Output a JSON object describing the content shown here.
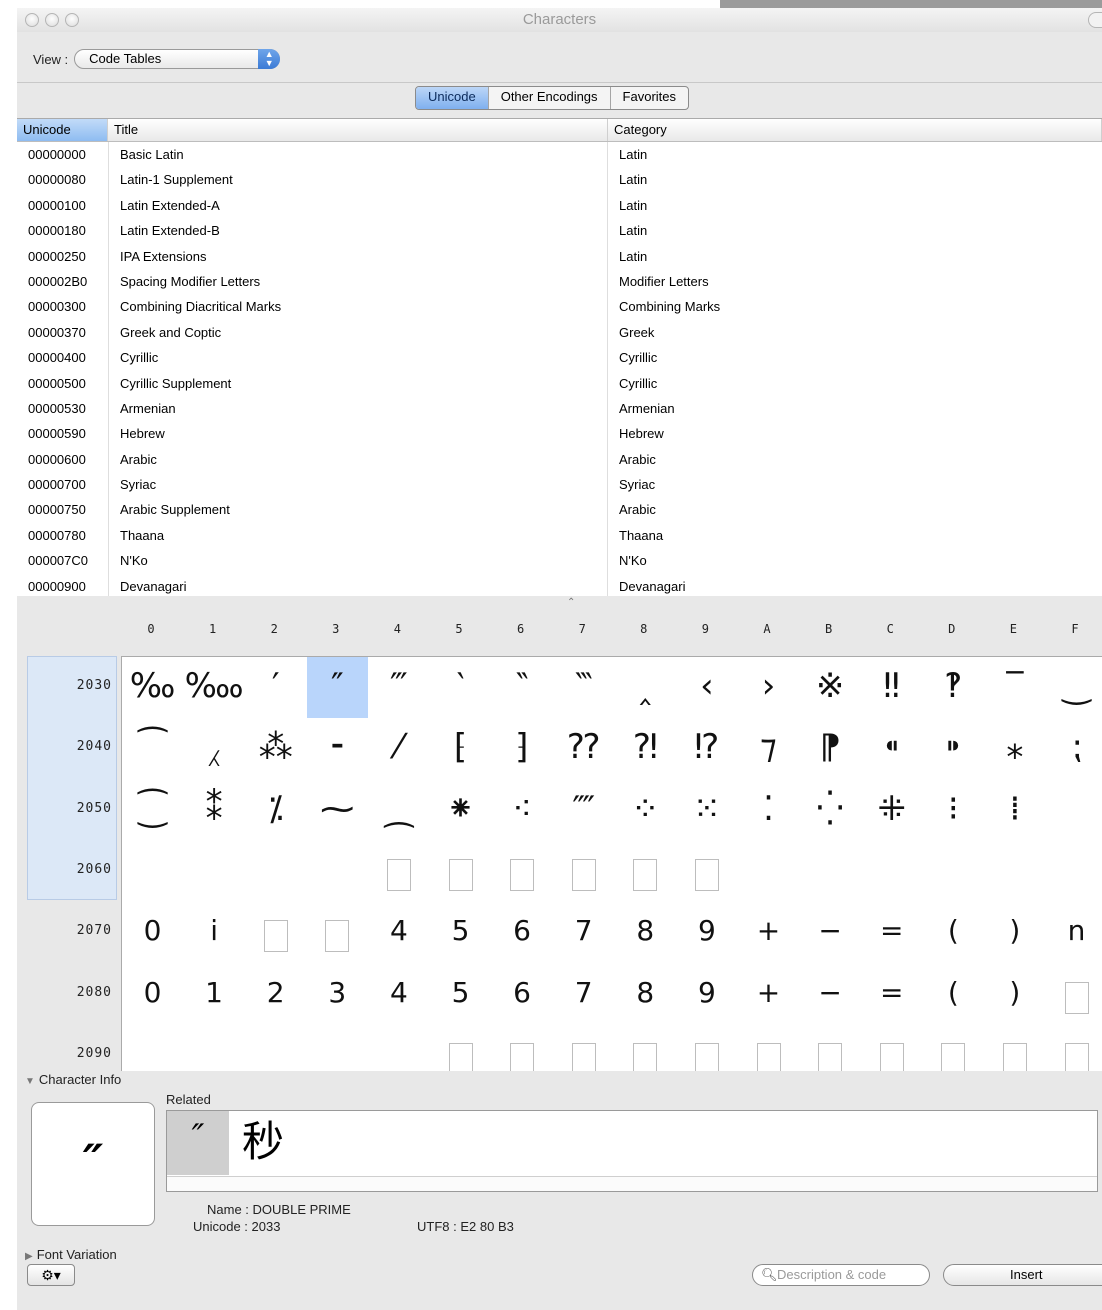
{
  "window": {
    "title": "Characters"
  },
  "view": {
    "label": "View :",
    "selected": "Code Tables"
  },
  "tabs": [
    "Unicode",
    "Other Encodings",
    "Favorites"
  ],
  "table": {
    "headers": [
      "Unicode",
      "Title",
      "Category"
    ],
    "rows": [
      [
        "00000000",
        "Basic Latin",
        "Latin"
      ],
      [
        "00000080",
        "Latin-1 Supplement",
        "Latin"
      ],
      [
        "00000100",
        "Latin Extended-A",
        "Latin"
      ],
      [
        "00000180",
        "Latin Extended-B",
        "Latin"
      ],
      [
        "00000250",
        "IPA Extensions",
        "Latin"
      ],
      [
        "000002B0",
        "Spacing Modifier Letters",
        "Modifier Letters"
      ],
      [
        "00000300",
        "Combining Diacritical Marks",
        "Combining Marks"
      ],
      [
        "00000370",
        "Greek and Coptic",
        "Greek"
      ],
      [
        "00000400",
        "Cyrillic",
        "Cyrillic"
      ],
      [
        "00000500",
        "Cyrillic Supplement",
        "Cyrillic"
      ],
      [
        "00000530",
        "Armenian",
        "Armenian"
      ],
      [
        "00000590",
        "Hebrew",
        "Hebrew"
      ],
      [
        "00000600",
        "Arabic",
        "Arabic"
      ],
      [
        "00000700",
        "Syriac",
        "Syriac"
      ],
      [
        "00000750",
        "Arabic Supplement",
        "Arabic"
      ],
      [
        "00000780",
        "Thaana",
        "Thaana"
      ],
      [
        "000007C0",
        "N'Ko",
        "N'Ko"
      ],
      [
        "00000900",
        "Devanagari",
        "Devanagari"
      ]
    ]
  },
  "grid": {
    "columns": [
      "0",
      "1",
      "2",
      "3",
      "4",
      "5",
      "6",
      "7",
      "8",
      "9",
      "A",
      "B",
      "C",
      "D",
      "E",
      "F"
    ],
    "rows": [
      {
        "label": "2030",
        "cells": [
          "‰",
          "‱",
          "′",
          "″",
          "‴",
          "‵",
          "‶",
          "‷",
          "‸",
          "‹",
          "›",
          "※",
          "‼",
          "‽",
          "‾",
          "‿"
        ]
      },
      {
        "label": "2040",
        "cells": [
          "⁀",
          "⁁",
          "⁂",
          "⁃",
          "⁄",
          "⁅",
          "⁆",
          "⁇",
          "⁈",
          "⁉",
          "⁊",
          "⁋",
          "⁌",
          "⁍",
          "⁎",
          "⁏"
        ]
      },
      {
        "label": "2050",
        "cells": [
          "⁐",
          "⁑",
          "⁒",
          "⁓",
          "⁔",
          "⁕",
          "⁖",
          "⁗",
          "⁘",
          "⁙",
          "⁚",
          "⁛",
          "⁜",
          "⁝",
          "⁞",
          ""
        ]
      },
      {
        "label": "2060",
        "cells": [
          "",
          "",
          "",
          "",
          "□",
          "□",
          "□",
          "□",
          "□",
          "□",
          "",
          "",
          "",
          "",
          "",
          ""
        ]
      },
      {
        "label": "2070",
        "cells": [
          "0",
          "i",
          "□",
          "□",
          "4",
          "5",
          "6",
          "7",
          "8",
          "9",
          "+",
          "−",
          "=",
          "(",
          ")",
          "n"
        ]
      },
      {
        "label": "2080",
        "cells": [
          "0",
          "1",
          "2",
          "3",
          "4",
          "5",
          "6",
          "7",
          "8",
          "9",
          "+",
          "−",
          "=",
          "(",
          ")",
          "□"
        ]
      },
      {
        "label": "2090",
        "cells": [
          "",
          "",
          "",
          "",
          "",
          "□",
          "□",
          "□",
          "□",
          "□",
          "□",
          "□",
          "□",
          "□",
          "□",
          "□"
        ]
      }
    ],
    "selected": "2033"
  },
  "info": {
    "section_label": "Character Info",
    "glyph": "″",
    "related_label": "Related",
    "related": [
      "″",
      "秒"
    ],
    "name_label": "Name :",
    "name_value": "DOUBLE PRIME",
    "unicode_label": "Unicode :",
    "unicode_value": "2033",
    "utf8_label": "UTF8 :",
    "utf8_value": "E2 80 B3",
    "font_variation_label": "Font Variation"
  },
  "bottom": {
    "search_placeholder": "Description & code",
    "insert_label": "Insert"
  }
}
